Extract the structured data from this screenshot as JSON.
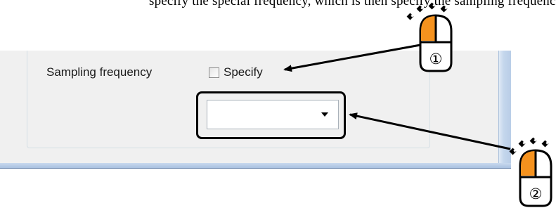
{
  "instruction": {
    "clipped_text": "specify the special frequency, which is then specify the sampling frequency from the drop-down"
  },
  "dialog": {
    "sampling_label": "Sampling frequency",
    "specify_checkbox": {
      "label": "Specify",
      "checked": false
    },
    "frequency_select": {
      "value": ""
    }
  },
  "callouts": [
    {
      "number": "①",
      "target": "Specify checkbox"
    },
    {
      "number": "②",
      "target": "sampling frequency drop-down"
    }
  ],
  "colors": {
    "mouse_button_highlight": "#f5921e",
    "dialog_background": "#f0f0f0",
    "window_frame": "#b9cde7"
  }
}
